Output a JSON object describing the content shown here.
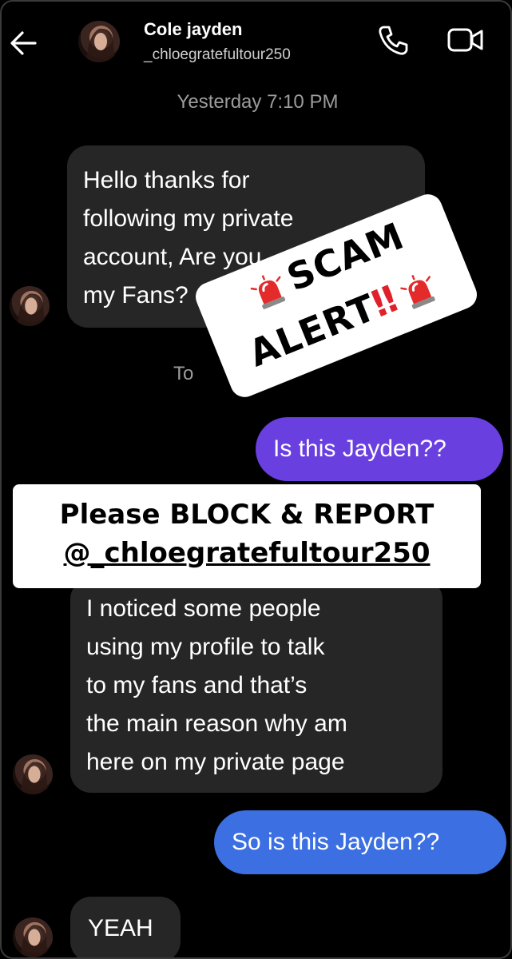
{
  "header": {
    "contact_name": "Cole jayden",
    "contact_handle": "_chloegratefultour250",
    "icons": [
      "back-arrow-icon",
      "phone-icon",
      "video-camera-icon"
    ]
  },
  "conversation": {
    "timestamp_1": "Yesterday 7:10 PM",
    "timestamp_2_partial": "To",
    "messages": [
      {
        "sender": "contact",
        "lines": [
          "Hello thanks for",
          "following my private",
          "account, Are you",
          "my Fans?"
        ]
      },
      {
        "sender": "me",
        "text": "Is this Jayden??"
      },
      {
        "sender": "contact",
        "lines": [
          "I noticed some people",
          "using my profile to talk",
          "to my fans and that’s",
          "the main reason why am",
          "here on my private page"
        ]
      },
      {
        "sender": "me",
        "text": "So is this Jayden??"
      },
      {
        "sender": "contact",
        "text": "YEAH"
      }
    ]
  },
  "overlay": {
    "sticker_line1": "SCAM",
    "sticker_line2": "ALERT",
    "sticker_bangs": "‼",
    "sticker_icon": "siren-icon",
    "banner_line1": "Please BLOCK & REPORT",
    "banner_line2": "@_chloegratefultour250"
  },
  "colors": {
    "outgoing_purple": "#6a3fe0",
    "outgoing_blue": "#3b6fe2",
    "incoming": "#262626",
    "alert_red": "#e0202a"
  }
}
